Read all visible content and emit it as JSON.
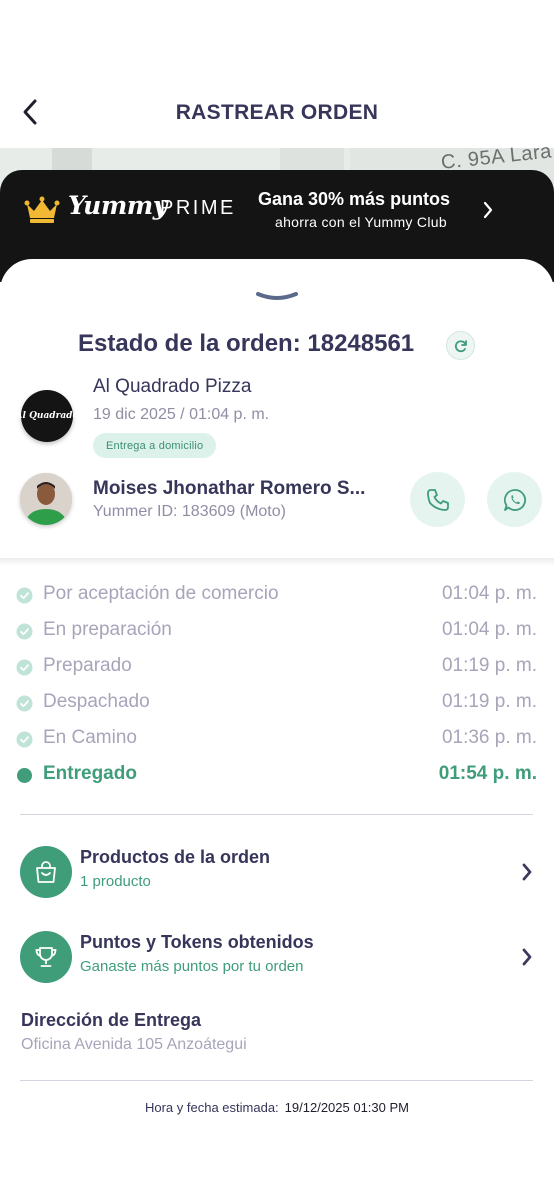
{
  "header": {
    "title": "RASTREAR ORDEN"
  },
  "map": {
    "street_label": "C. 95A Lara"
  },
  "promo": {
    "brand_name": "Yummy",
    "brand_suffix": "PRIME",
    "title": "Gana 30% más puntos",
    "subtitle": "ahorra con el Yummy Club",
    "colors": {
      "background": "#141414",
      "crown": "#f1b933"
    }
  },
  "order": {
    "status_title": "Estado de la orden: 18248561",
    "store": {
      "logo_text": "Al Quadrado",
      "name": "Al Quadrado Pizza",
      "date": "19 dic 2025 / 01:04 p. m.",
      "delivery_type": "Entrega a domicilio"
    },
    "courier": {
      "name": "Moises Jhonathar Romero S...",
      "id": "Yummer ID: 183609 (Moto)"
    }
  },
  "timeline": [
    {
      "label": "Por aceptación de comercio",
      "time": "01:04 p. m.",
      "state": "done"
    },
    {
      "label": "En preparación",
      "time": "01:04 p. m.",
      "state": "done"
    },
    {
      "label": "Preparado",
      "time": "01:19 p. m.",
      "state": "done"
    },
    {
      "label": "Despachado",
      "time": "01:19 p. m.",
      "state": "done"
    },
    {
      "label": "En Camino",
      "time": "01:36 p. m.",
      "state": "done"
    },
    {
      "label": "Entregado",
      "time": "01:54 p. m.",
      "state": "current"
    }
  ],
  "cards": [
    {
      "title": "Productos de la orden",
      "subtitle": "1 producto",
      "icon": "shopping-bag-icon"
    },
    {
      "title": "Puntos y Tokens obtenidos",
      "subtitle": "Ganaste más puntos por tu orden",
      "icon": "trophy-icon"
    }
  ],
  "address": {
    "title": "Dirección de Entrega",
    "value": "Oficina Avenida 105 Anzoátegui"
  },
  "eta": {
    "label": "Hora y fecha estimada:",
    "value": "19/12/2025 01:30 PM"
  },
  "theme": {
    "accent": "#3f9d7a",
    "text_dark": "#36355a",
    "text_muted": "#a6a5ba",
    "badge_bg": "#dcf1ea"
  }
}
